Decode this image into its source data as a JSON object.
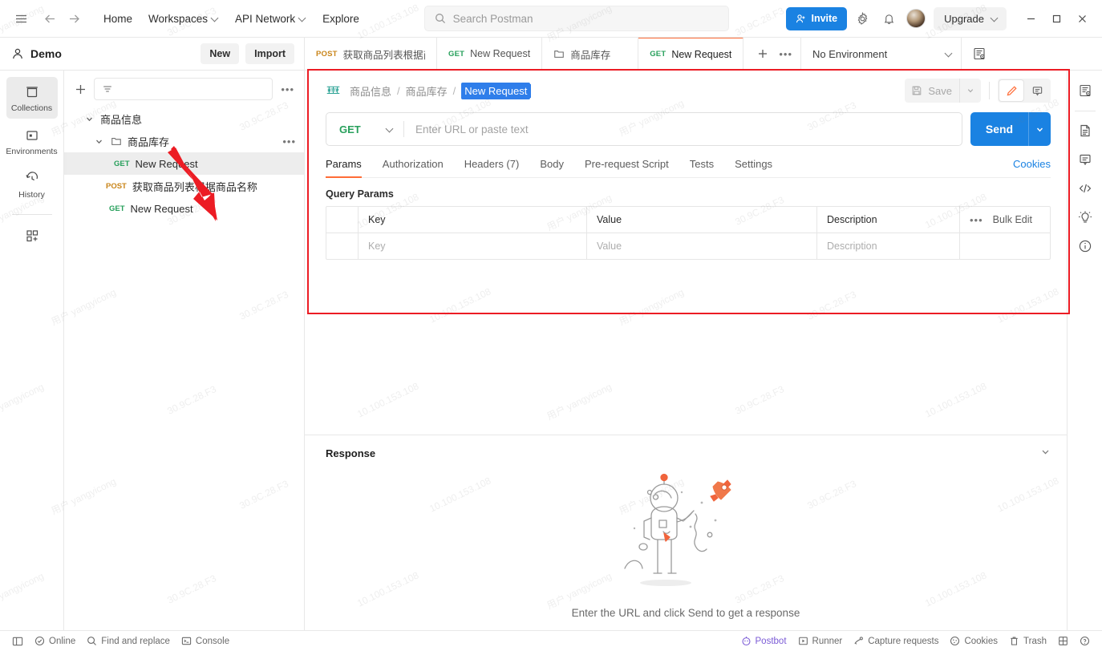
{
  "topbar": {
    "menu_icon": "hamburger-icon",
    "back_icon": "arrow-left-icon",
    "forward_icon": "arrow-right-icon",
    "links": [
      {
        "label": "Home",
        "caret": false
      },
      {
        "label": "Workspaces",
        "caret": true
      },
      {
        "label": "API Network",
        "caret": true
      },
      {
        "label": "Explore",
        "caret": false
      }
    ],
    "search_placeholder": "Search Postman",
    "invite_label": "Invite",
    "settings_icon": "gear-icon",
    "notifications_icon": "bell-icon",
    "avatar": "avatar",
    "upgrade_label": "Upgrade",
    "window": {
      "minimize": "minimize-icon",
      "maximize": "maximize-icon",
      "close": "close-icon"
    }
  },
  "workspace": {
    "name": "Demo",
    "new_label": "New",
    "import_label": "Import"
  },
  "tabs": [
    {
      "method": "POST",
      "title": "获取商品列表根据商品名称",
      "active": false,
      "type": "request"
    },
    {
      "method": "GET",
      "title": "New Request",
      "active": false,
      "type": "request"
    },
    {
      "method": "",
      "title": "商品库存",
      "active": false,
      "type": "folder"
    },
    {
      "method": "GET",
      "title": "New Request",
      "active": true,
      "type": "request"
    }
  ],
  "tab_tools": {
    "add_icon": "plus-icon",
    "more_icon": "ellipsis-icon"
  },
  "environment": {
    "selected": "No Environment",
    "eye_icon": "environment-quick-look-icon"
  },
  "rail": [
    {
      "label": "Collections",
      "icon": "collections-icon",
      "selected": true
    },
    {
      "label": "Environments",
      "icon": "environments-icon",
      "selected": false
    },
    {
      "label": "History",
      "icon": "history-icon",
      "selected": false
    },
    {
      "label": "",
      "icon": "add-module-icon",
      "selected": false
    }
  ],
  "sidebar": {
    "add_icon": "plus-icon",
    "filter_placeholder": "",
    "filter_icon": "filter-icon",
    "more_icon": "ellipsis-icon",
    "tree": [
      {
        "level": 0,
        "label": "商品信息",
        "method": "",
        "chevron": "down",
        "selected": false,
        "kind": "collection"
      },
      {
        "level": 1,
        "label": "商品库存",
        "method": "",
        "chevron": "down",
        "selected": false,
        "kind": "folder",
        "more": true
      },
      {
        "level": 2,
        "label": "New Request",
        "method": "GET",
        "chevron": "",
        "selected": true,
        "kind": "request"
      },
      {
        "level": 2,
        "label": "获取商品列表根据商品名称",
        "method": "POST",
        "chevron": "",
        "selected": false,
        "kind": "request"
      },
      {
        "level": 2,
        "label": "New Request",
        "method": "GET",
        "chevron": "",
        "selected": false,
        "kind": "request"
      }
    ]
  },
  "request": {
    "protocol_icon": "http-icon",
    "breadcrumb": [
      "商品信息",
      "商品库存"
    ],
    "name": "New Request",
    "name_editing": true,
    "save_label": "Save",
    "save_disabled": true,
    "save_icon": "floppy-disk-icon",
    "edit_icon": "pencil-icon",
    "comment_icon": "comment-icon",
    "method": "GET",
    "url_placeholder": "Enter URL or paste text",
    "url_value": "",
    "send_label": "Send",
    "tabs": [
      {
        "label": "Params",
        "active": true
      },
      {
        "label": "Authorization",
        "active": false
      },
      {
        "label": "Headers (7)",
        "active": false
      },
      {
        "label": "Body",
        "active": false
      },
      {
        "label": "Pre-request Script",
        "active": false
      },
      {
        "label": "Tests",
        "active": false
      },
      {
        "label": "Settings",
        "active": false
      }
    ],
    "cookies_label": "Cookies",
    "query_params_title": "Query Params",
    "table": {
      "headers": [
        "Key",
        "Value",
        "Description"
      ],
      "bulk_edit_label": "Bulk Edit",
      "bulk_more_icon": "ellipsis-icon",
      "rows": [
        {
          "key": "Key",
          "value": "Value",
          "description": "Description",
          "placeholder": true
        }
      ]
    }
  },
  "response": {
    "title": "Response",
    "collapse_icon": "chevron-down-icon",
    "empty_hint": "Enter the URL and click Send to get a response",
    "illustration": "astronaut-with-rocket-illustration"
  },
  "right_rail": [
    {
      "icon": "environment-quick-look-icon"
    },
    {
      "icon": "documentation-icon"
    },
    {
      "icon": "comments-icon"
    },
    {
      "icon": "code-snippet-icon"
    },
    {
      "icon": "lightbulb-icon"
    },
    {
      "icon": "info-icon"
    }
  ],
  "statusbar": {
    "left": [
      {
        "label": "",
        "icon": "sidebar-toggle-icon"
      },
      {
        "label": "Online",
        "icon": "check-circle-icon"
      },
      {
        "label": "Find and replace",
        "icon": "search-icon"
      },
      {
        "label": "Console",
        "icon": "terminal-icon"
      }
    ],
    "right": [
      {
        "label": "Postbot",
        "icon": "postbot-icon",
        "accent": true
      },
      {
        "label": "Runner",
        "icon": "runner-icon"
      },
      {
        "label": "Capture requests",
        "icon": "capture-icon"
      },
      {
        "label": "Cookies",
        "icon": "cookie-icon"
      },
      {
        "label": "Trash",
        "icon": "trash-icon"
      },
      {
        "label": "",
        "icon": "layout-icon"
      },
      {
        "label": "",
        "icon": "help-icon"
      }
    ]
  },
  "annotations": {
    "highlight_rect_color": "#ec1c24",
    "arrow_color": "#ec1c24",
    "arrow_points_to": "sidebar-item-new-request"
  },
  "colors": {
    "accent_orange": "#ff6c37",
    "primary_blue": "#1a82e2",
    "method_get": "#28a05c",
    "method_post": "#c9851a",
    "postbot_purple": "#7b5bd6"
  },
  "watermarks": [
    "用户 yangyicong",
    "30.9C.28.F3",
    "10.100.153.108",
    "用户 yangyicong",
    "30.9C.28.F3",
    "10.100.153.108",
    "用户 yangyicong",
    "30.9C.28.F3",
    "10.100.153.108",
    "用户 yangyicong",
    "30.9C.28.F3",
    "10.100.153.108",
    "用户 yangyicong",
    "30.9C.28.F3",
    "10.100.153.108",
    "用户 yangyicong",
    "30.9C.28.F3",
    "10.100.153.108",
    "用户 yangyicong",
    "30.9C.28.F3",
    "10.100.153.108",
    "用户 yangyicong",
    "30.9C.28.F3",
    "10.100.153.108"
  ]
}
